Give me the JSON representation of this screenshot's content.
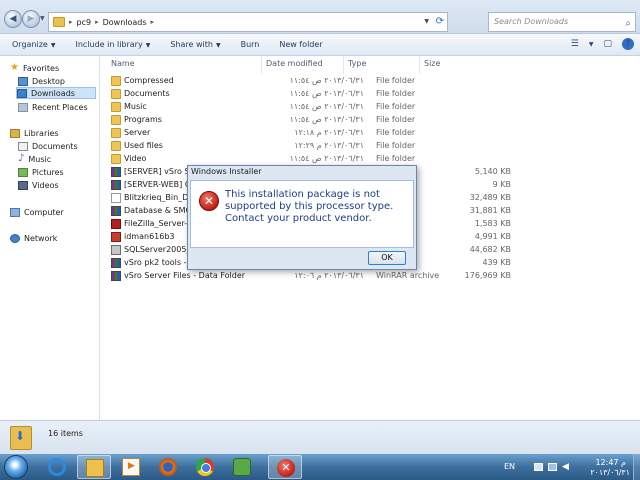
{
  "address": {
    "crumbs": [
      "pc9",
      "Downloads"
    ],
    "search_placeholder": "Search Downloads"
  },
  "toolbar": {
    "organize": "Organize",
    "include": "Include in library",
    "share": "Share with",
    "burn": "Burn",
    "new_folder": "New folder"
  },
  "nav": {
    "favorites": "Favorites",
    "desktop": "Desktop",
    "downloads": "Downloads",
    "recent": "Recent Places",
    "libraries": "Libraries",
    "documents": "Documents",
    "music": "Music",
    "pictures": "Pictures",
    "videos": "Videos",
    "computer": "Computer",
    "network": "Network"
  },
  "columns": {
    "name": "Name",
    "date": "Date modified",
    "type": "Type",
    "size": "Size"
  },
  "files": [
    {
      "name": "Compressed",
      "date": "٢٠١٣/٠٦/٣١ ص ١١:٥٤",
      "type": "File folder",
      "size": ""
    },
    {
      "name": "Documents",
      "date": "٢٠١٣/٠٦/٣١ ص ١١:٥٤",
      "type": "File folder",
      "size": ""
    },
    {
      "name": "Music",
      "date": "٢٠١٣/٠٦/٣١ ص ١١:٥٤",
      "type": "File folder",
      "size": ""
    },
    {
      "name": "Programs",
      "date": "٢٠١٣/٠٦/٣١ ص ١١:٥٤",
      "type": "File folder",
      "size": ""
    },
    {
      "name": "Server",
      "date": "٢٠١٣/٠٦/٣١ م ١٢:١٨",
      "type": "File folder",
      "size": ""
    },
    {
      "name": "Used files",
      "date": "٢٠١٣/٠٦/٣١ م ١٢:٢٩",
      "type": "File folder",
      "size": ""
    },
    {
      "name": "Video",
      "date": "٢٠١٣/٠٦/٣١ ص ١١:٥٤",
      "type": "File folder",
      "size": ""
    },
    {
      "name": "[SERVER] vSro Server",
      "date": "",
      "type": "",
      "size": "5,140 KB"
    },
    {
      "name": "[SERVER-WEB] CGI_",
      "date": "",
      "type": "",
      "size": "9 KB"
    },
    {
      "name": "Blitzkrieq_Bin_Data.",
      "date": "",
      "type": "",
      "size": "32,489 KB"
    },
    {
      "name": "Database & SMC",
      "date": "",
      "type": "",
      "size": "31,881 KB"
    },
    {
      "name": "FileZilla_Server-0_9_",
      "date": "",
      "type": "",
      "size": "1,583 KB"
    },
    {
      "name": "idman616b3",
      "date": "",
      "type": "",
      "size": "4,991 KB"
    },
    {
      "name": "SQLServer2005_SSM",
      "date": "",
      "type": "",
      "size": "44,682 KB"
    },
    {
      "name": "vSro pk2 tools - Rec",
      "date": "",
      "type": "",
      "size": "439 KB"
    },
    {
      "name": "vSro Server Files - Data Folder",
      "date": "٢٠١٣/٠٦/٣١ م ١٢:٠٦",
      "type": "WinRAR archive",
      "size": "176,969 KB"
    }
  ],
  "dialog": {
    "title": "Windows Installer",
    "message": "This installation package is not supported by this processor type. Contact your product vendor.",
    "ok": "OK"
  },
  "status": {
    "items": "16 items"
  },
  "tray": {
    "lang": "EN",
    "time": "12:47 م",
    "date": "٢٠١٣/٠٦/٣١"
  }
}
